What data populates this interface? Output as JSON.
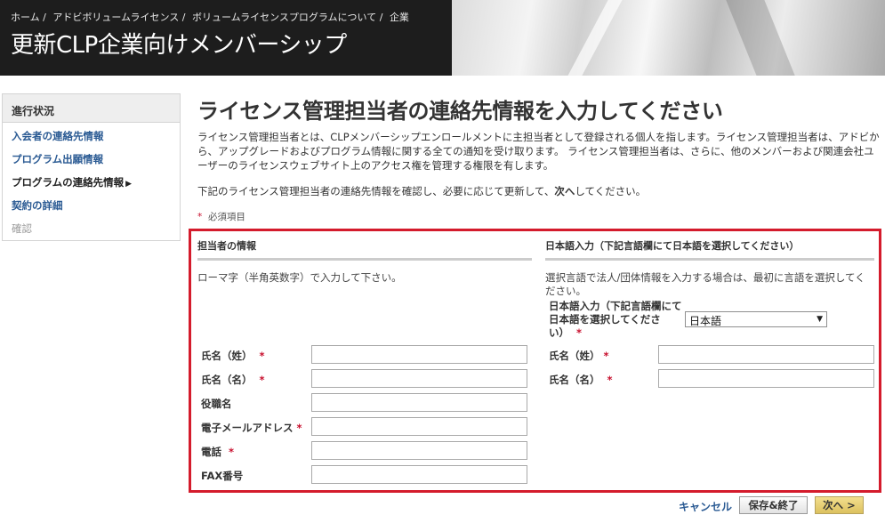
{
  "header": {
    "breadcrumb": [
      "ホーム /",
      "アドビボリュームライセンス /",
      "ボリュームライセンスプログラムについて /",
      "企業"
    ],
    "title": "更新CLP企業向けメンバーシップ"
  },
  "sidebar": {
    "heading": "進行状況",
    "items": [
      {
        "label": "入会者の連絡先情報"
      },
      {
        "label": "プログラム出願情報"
      },
      {
        "label": "プログラムの連絡先情報"
      },
      {
        "label": "契約の詳細"
      },
      {
        "label": "確認"
      }
    ],
    "current_marker": "▶"
  },
  "main": {
    "heading": "ライセンス管理担当者の連絡先情報を入力してください",
    "intro": "ライセンス管理担当者とは、CLPメンバーシップエンロールメントに主担当者として登録される個人を指します。ライセンス管理担当者は、アドビから、アップグレードおよびプログラム情報に関する全ての通知を受け取ります。 ライセンス管理担当者は、さらに、他のメンバーおよび関連会社ユーザーのライセンスウェブサイト上のアクセス権を管理する権限を有します。",
    "instruction_before": "下記のライセンス管理担当者の連絡先情報を確認し、必要に応じて更新して、",
    "instruction_bold": "次へ",
    "instruction_after": "してください。",
    "required_star": "*",
    "required_note": "必須項目"
  },
  "form": {
    "left": {
      "heading": "担当者の情報",
      "note": "ローマ字（半角英数字）で入力して下さい。",
      "fields": [
        {
          "label": "氏名（姓）",
          "required": "*"
        },
        {
          "label": "氏名（名）",
          "required": "*"
        },
        {
          "label": "役職名",
          "required": ""
        },
        {
          "label": "電子メールアドレス",
          "required": "*"
        },
        {
          "label": "電話",
          "required": "*"
        },
        {
          "label": "FAX番号",
          "required": ""
        }
      ]
    },
    "right": {
      "heading": "日本語入力（下記言語欄にて日本語を選択してください）",
      "note": "選択言語で法人/団体情報を入力する場合は、最初に言語を選択してください。",
      "language_label": "日本語入力（下記言語欄にて日本語を選択してください）",
      "language_required": "*",
      "language_value": "日本語",
      "fields": [
        {
          "label": "氏名（姓）",
          "required": "*"
        },
        {
          "label": "氏名（名）",
          "required": "*"
        }
      ]
    }
  },
  "footer": {
    "cancel_label": "キャンセル",
    "save_label": "保存&終了",
    "next_label": "次へ >"
  },
  "colors": {
    "form_border": "#d41b2c",
    "link": "#2a5a93",
    "required": "#c8102e",
    "next_button": "#e5cb72"
  }
}
